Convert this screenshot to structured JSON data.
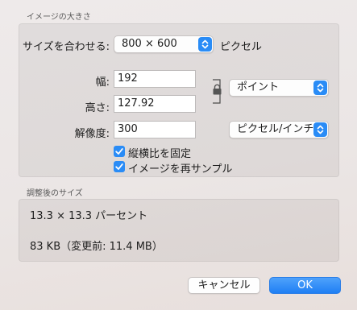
{
  "image_size_section": {
    "title": "イメージの大きさ",
    "fit_to": {
      "label": "サイズを合わせる:",
      "value": "800 × 600",
      "unit": "ピクセル"
    },
    "width": {
      "label": "幅:",
      "value": "192"
    },
    "height": {
      "label": "高さ:",
      "value": "127.92"
    },
    "size_unit": "ポイント",
    "resolution": {
      "label": "解像度:",
      "value": "300",
      "unit": "ピクセル/インチ"
    },
    "scale_proportionally": {
      "label": "縦横比を固定",
      "checked": true
    },
    "resample_image": {
      "label": "イメージを再サンプル",
      "checked": true
    }
  },
  "result_section": {
    "title": "調整後のサイズ",
    "dimensions_text": "13.3 × 13.3 パーセント",
    "file_size_text": "83 KB（変更前: 11.4 MB）"
  },
  "buttons": {
    "cancel": "キャンセル",
    "ok": "OK"
  },
  "colors": {
    "accent": "#2a8cf6"
  },
  "icons": {
    "lock": "lock-icon",
    "stepper": "updown-chevron-icon",
    "check": "checkmark-icon"
  }
}
